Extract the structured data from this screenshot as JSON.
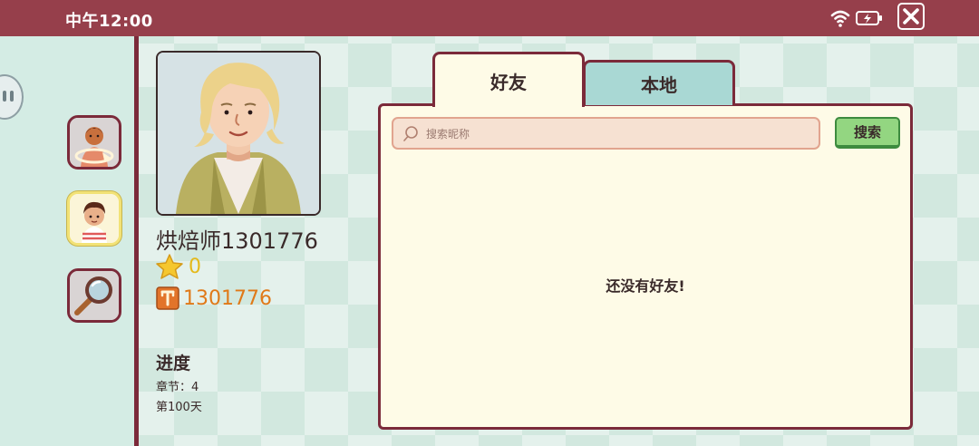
{
  "status_bar": {
    "time": "中午12:00"
  },
  "profile": {
    "name": "烘焙师1301776",
    "stars": "0",
    "id_value": "1301776"
  },
  "progress": {
    "title": "进度",
    "chapter": "章节：4",
    "day": "第100天"
  },
  "tabs": [
    {
      "label": "好友",
      "active": true
    },
    {
      "label": "本地",
      "active": false
    }
  ],
  "search": {
    "placeholder": "搜索昵称",
    "button_label": "搜索"
  },
  "friends": {
    "empty_message": "还没有好友!"
  },
  "colors": {
    "header": "#963f4b",
    "border": "#7b2a3a",
    "panel": "#fefbe7",
    "tab_inactive": "#a9d8d4",
    "search_button": "#93d681",
    "star_text": "#e4b91a",
    "id_text": "#e07918"
  },
  "icons": {
    "status": [
      "wifi-icon",
      "battery-charging-icon",
      "close-icon"
    ],
    "sidebar": [
      "pause-icon",
      "world-character-icon",
      "player-avatar-icon",
      "magnifier-icon"
    ],
    "stats": [
      "star-icon",
      "id-badge-icon"
    ]
  }
}
